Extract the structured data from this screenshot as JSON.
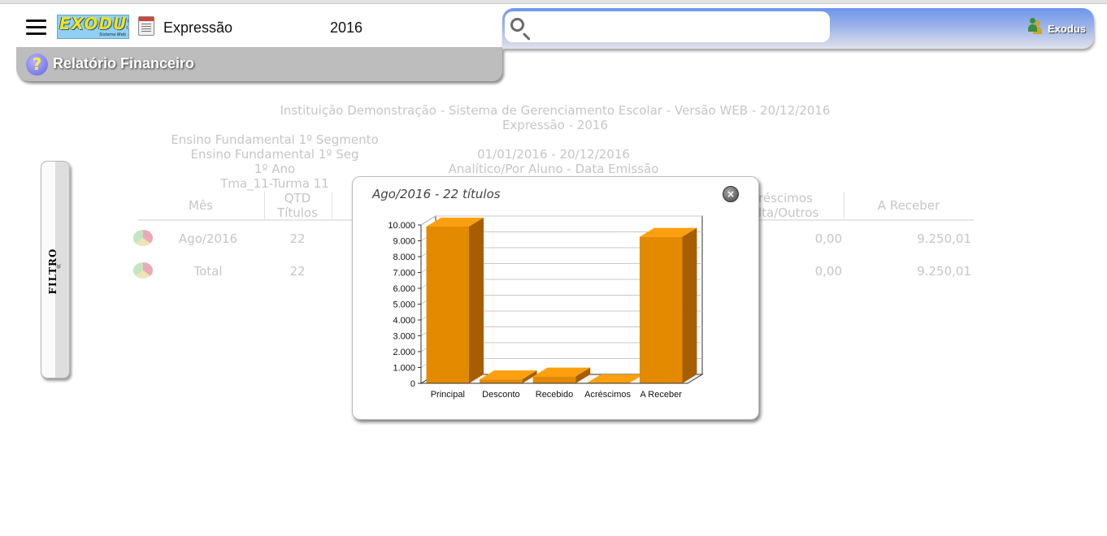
{
  "header": {
    "logo_text": "EXODUS",
    "logo_subtext": "Sistema Web",
    "app_name": "Expressão",
    "year": "2016",
    "user_name": "Exodus",
    "search_placeholder": ""
  },
  "title_bar": {
    "title": "Relatório Financeiro",
    "help_symbol": "?"
  },
  "filter_tab": {
    "label": "FILTRO",
    "chevron": "»"
  },
  "report": {
    "header_line1": "Instituição Demonstração - Sistema de Gerenciamento Escolar - Versão WEB - 20/12/2016",
    "header_line2": "Expressão - 2016",
    "segment": "Ensino Fundamental 1º Segmento",
    "segment_short": "Ensino Fundamental 1º Seg",
    "grade": "1º Ano",
    "class": "Tma_11-Turma 11",
    "period": "01/01/2016 - 20/12/2016",
    "mode": "Analítico/Por Aluno - Data Emissão",
    "columns": {
      "mes": "Mês",
      "qtd_line1": "QTD",
      "qtd_line2": "Títulos",
      "acrescimos_line1": "réscimos",
      "acrescimos_line2": "lta/Outros",
      "a_receber": "A Receber"
    },
    "rows": [
      {
        "mes": "Ago/2016",
        "qtd": "22",
        "acrescimos": "0,00",
        "a_receber": "9.250,01"
      },
      {
        "mes": "Total",
        "qtd": "22",
        "acrescimos": "0,00",
        "a_receber": "9.250,01"
      }
    ]
  },
  "modal": {
    "title": "Ago/2016 - 22 títulos",
    "close_symbol": "×"
  },
  "chart_data": {
    "type": "bar",
    "title": "Ago/2016 - 22 títulos",
    "categories": [
      "Principal",
      "Desconto",
      "Recebido",
      "Acréscimos",
      "A Receber"
    ],
    "values": [
      9900,
      250,
      430,
      0,
      9250
    ],
    "ylim": [
      0,
      10000
    ],
    "yticks": [
      0,
      1000,
      2000,
      3000,
      4000,
      5000,
      6000,
      7000,
      8000,
      9000,
      10000
    ],
    "ytick_labels": [
      "0",
      "1.000",
      "2.000",
      "3.000",
      "4.000",
      "5.000",
      "6.000",
      "7.000",
      "8.000",
      "9.000",
      "10.000"
    ],
    "xlabel": "",
    "ylabel": "",
    "grid": true,
    "style": "3d",
    "colors": {
      "front": "#e38a00",
      "top": "#fca010",
      "side": "#a65e00"
    }
  }
}
